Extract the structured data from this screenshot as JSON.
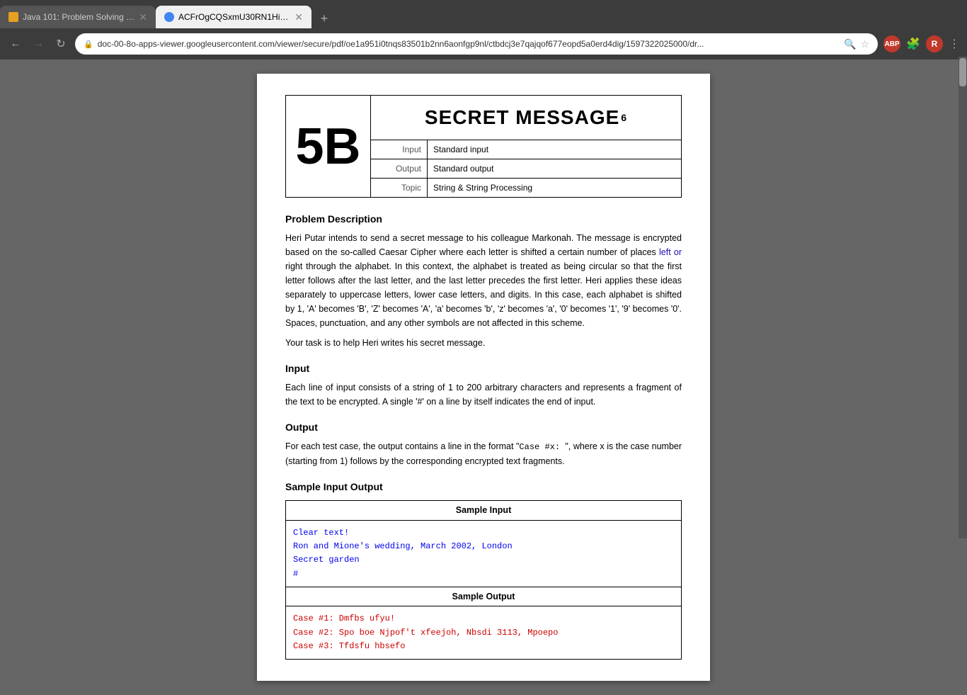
{
  "browser": {
    "tabs": [
      {
        "id": "tab1",
        "label": "Java 101: Problem Solving Practi...",
        "favicon_type": "java",
        "active": false
      },
      {
        "id": "tab2",
        "label": "ACFrOgCQSxmU30RN1HiZTMq...",
        "favicon_type": "pdf",
        "active": true
      }
    ],
    "new_tab_label": "+",
    "address_bar": "doc-00-8o-apps-viewer.googleusercontent.com/viewer/secure/pdf/oe1a951i0tnqs83501b2nn6aonfgp9nl/ctbdcj3e7qajqof677eopd5a0erd4dig/1597322025000/dr...",
    "nav_back": "←",
    "nav_reload": "↻",
    "ext_abp": "ABP",
    "avatar": "R"
  },
  "problem": {
    "number": "5B",
    "title": "SECRET MESSAGE",
    "title_sup": "6",
    "input_label": "Input",
    "input_value": "Standard input",
    "output_label": "Output",
    "output_value": "Standard output",
    "topic_label": "Topic",
    "topic_value": "String & String Processing",
    "sections": {
      "description_title": "Problem Description",
      "description_text": "Heri Putar intends to send a secret message to his colleague Markonah. The message is encrypted based on the so-called Caesar Cipher where each letter is shifted a certain number of places left or right through the alphabet. In this context, the alphabet is treated as being circular so that the first letter follows after the last letter, and the last letter precedes the first letter. Heri applies these ideas separately to uppercase letters, lower case letters, and digits. In this case, each alphabet is shifted by 1, 'A' becomes 'B', 'Z' becomes 'A', 'a' becomes 'b', 'z' becomes 'a', '0' becomes '1', '9' becomes '0'. Spaces, punctuation, and any other symbols are not affected in this scheme.",
      "description_task": "Your task is to help Heri writes his secret message.",
      "input_title": "Input",
      "input_text": "Each line of input consists of a string of 1 to 200 arbitrary characters and represents a fragment of the text to be encrypted. A single '#' on a line by itself indicates the end of input.",
      "output_title": "Output",
      "output_text_before": "For each test case, the output contains a line in the format \"",
      "output_code": "Case #x: ",
      "output_text_after": "\", where x is the case number (starting from 1) follows by the corresponding encrypted text fragments.",
      "sample_title": "Sample Input Output",
      "sample_input_header": "Sample Input",
      "sample_input_lines": [
        "Clear text!",
        "Ron and Mione's wedding, March 2002, London",
        "Secret garden",
        "#"
      ],
      "sample_output_header": "Sample Output",
      "sample_output_lines": [
        "Case #1: Dmfbs ufyu!",
        "Case #2: Spo boe Njpof't xfeejoh, Nbsdi 3113, Mpoepo",
        "Case #3: Tfdsfu hbsefo"
      ]
    }
  }
}
